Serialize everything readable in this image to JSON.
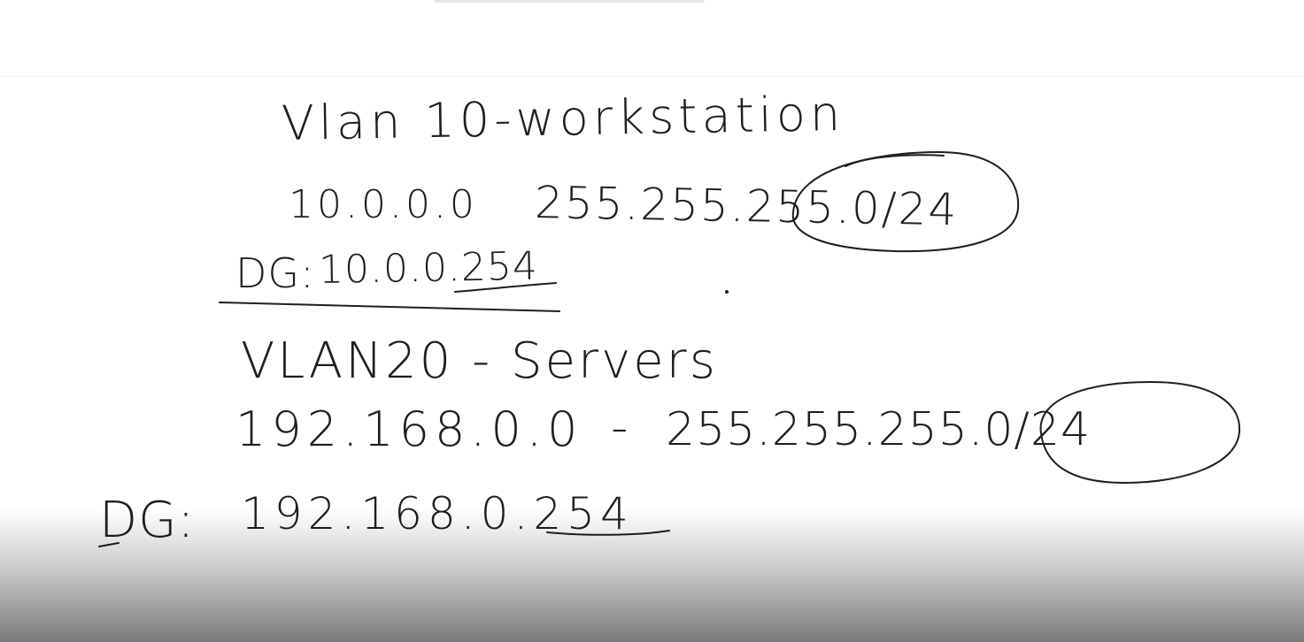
{
  "whiteboard": {
    "vlan10": {
      "title": "Vlan 10-workstation",
      "network": "10.0.0.0",
      "mask": "255.255.255.0/24",
      "gateway_label": "DG:",
      "gateway": "10.0.0.254"
    },
    "vlan20": {
      "title": "VLAN20 - Servers",
      "network": "192.168.0.0",
      "separator": "-",
      "mask": "255.255.255.0/24",
      "gateway_label": "DG:",
      "gateway": "192.168.0.254"
    }
  },
  "colors": {
    "ink": "#1e1e1e",
    "background": "#ffffff"
  }
}
